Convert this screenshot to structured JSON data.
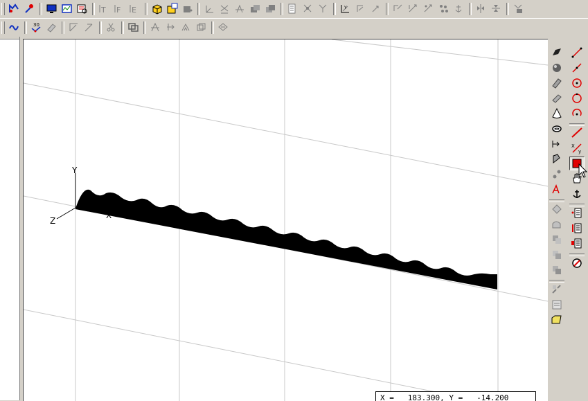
{
  "toolbar_top": {
    "groups": [
      [
        "profile-icon",
        "pin-icon"
      ],
      [
        "monitor-icon",
        "graph-window-icon",
        "table-window-icon"
      ],
      [
        "text-t-icon",
        "text-f-icon",
        "text-e-icon"
      ],
      [
        "cube-icon",
        "save-box-icon",
        "block-icon"
      ],
      [
        "axis-xyz-icon",
        "axis-xy-icon",
        "axis-yz-icon",
        "copy-solid-icon",
        "copy-solid-2-icon"
      ],
      [
        "document-icon",
        "move-point-icon",
        "fork-icon"
      ],
      [
        "measure-icon",
        "rotate-icon",
        "rotate-arrow-icon"
      ],
      [
        "flip-icon",
        "flip-2-icon",
        "flip-3-icon",
        "scatter-icon",
        "anchor-icon"
      ],
      [
        "mirror-icon",
        "mirror-2-icon"
      ],
      [
        "properties-icon"
      ]
    ]
  },
  "toolbar_bottom": {
    "groups": [
      [
        "curve-icon"
      ],
      [
        "polyline-30-icon",
        "eraser-icon"
      ],
      [
        "angle-icon",
        "angle-2-icon"
      ],
      [
        "scissors-icon"
      ],
      [
        "window-icon"
      ],
      [
        "trim-icon",
        "extend-icon",
        "offset-icon",
        "stretch-icon"
      ],
      [
        "hide-icon"
      ]
    ],
    "polyline_label": "30"
  },
  "viewport": {
    "axis_labels": {
      "x": "X",
      "y": "Y",
      "z": "Z"
    }
  },
  "status": {
    "coord_label": "X =   183.300, Y =   -14.200"
  },
  "palette_left": {
    "items": [
      "plane-icon",
      "sphere-icon",
      "cylinder-icon",
      "cylinder-2-icon",
      "cone-icon",
      "torus-icon",
      "extrude-icon",
      "revolve-icon",
      "points-icon",
      "text-a-icon",
      "sep",
      "fillet-icon",
      "chamfer-icon",
      "boolean-icon",
      "boolean-2-icon",
      "boolean-3-icon",
      "sep",
      "shell-icon",
      "properties-2-icon",
      "folder-icon"
    ]
  },
  "palette_right": {
    "items": [
      "line-icon",
      "line-2-icon",
      "circle-icon",
      "circle-2-icon",
      "arc-icon",
      "sep",
      "diag-line-icon",
      "x-label-icon",
      "rectangle-icon",
      "hand-icon",
      "anchor-2-icon",
      "sep",
      "list-icon",
      "list-2-icon",
      "list-3-icon",
      "sep",
      "no-snap-icon"
    ],
    "selected": "rectangle-icon"
  },
  "colors": {
    "accent_red": "#e00000",
    "toolbar_bg": "#d4d0c8",
    "icon_blue": "#1030c0",
    "grid": "#c0c0c0"
  }
}
